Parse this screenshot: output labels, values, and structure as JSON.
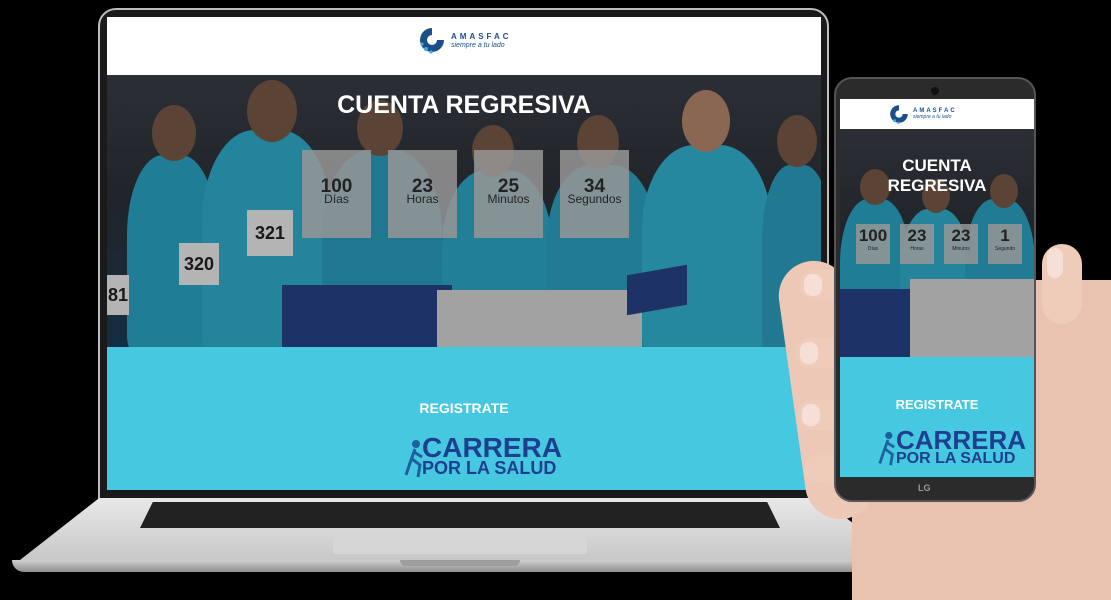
{
  "laptop": {
    "header": {
      "brand": "AMASFAC",
      "tagline": "siempre a tu lado"
    },
    "hero": {
      "title": "CUENTA REGRESIVA",
      "countdown": [
        {
          "value": "100",
          "label": "Días"
        },
        {
          "value": "23",
          "label": "Horas"
        },
        {
          "value": "25",
          "label": "Minutos"
        },
        {
          "value": "34",
          "label": "Segundos"
        }
      ],
      "bibs": [
        "321",
        "320",
        "81"
      ]
    },
    "register": {
      "title": "REGISTRATE",
      "event_line1": "CARRERA",
      "event_line2": "POR LA SALUD"
    }
  },
  "phone": {
    "header": {
      "brand": "AMASFAC",
      "tagline": "siempre a tu lado"
    },
    "hero": {
      "title_line1": "CUENTA",
      "title_line2": "REGRESIVA",
      "countdown": [
        {
          "value": "100",
          "label": "Días"
        },
        {
          "value": "23",
          "label": "Horas"
        },
        {
          "value": "23",
          "label": "Minutos"
        },
        {
          "value": "1",
          "label": "Segundo"
        }
      ]
    },
    "register": {
      "title": "REGISTRATE",
      "event_line1": "CARRERA",
      "event_line2": "POR LA SALUD"
    },
    "device_brand": "LG"
  },
  "colors": {
    "accent": "#45c8e0",
    "brand_blue": "#1c4f8a",
    "race_blue": "#1e3f8f"
  }
}
